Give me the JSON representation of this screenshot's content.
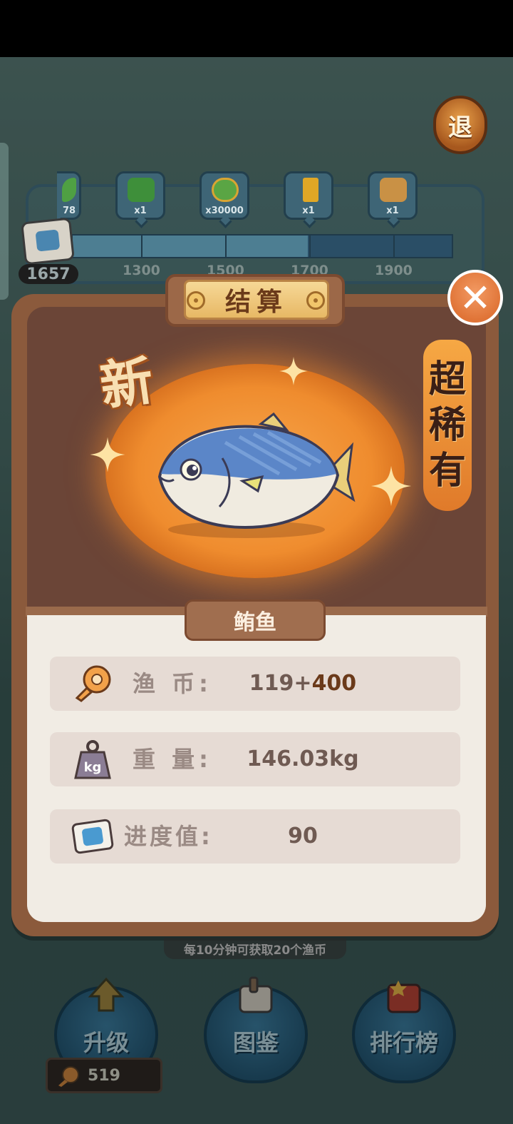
{
  "header": {
    "exit_label": "退"
  },
  "progress": {
    "current_score": "1657",
    "milestones": [
      "1300",
      "1500",
      "1700",
      "1900"
    ],
    "fill_fraction": 0.62,
    "rewards": [
      {
        "name": "leaf",
        "label": "78"
      },
      {
        "name": "leaf-check",
        "label": "x1"
      },
      {
        "name": "check-coin",
        "label": "x30000"
      },
      {
        "name": "gold-card",
        "label": "x1"
      },
      {
        "name": "cat-card",
        "label": "x1"
      }
    ]
  },
  "result": {
    "title": "结算",
    "new_tag": "新",
    "rarity": [
      "超",
      "稀",
      "有"
    ],
    "fish_name": "鲔鱼",
    "stats": {
      "coins": {
        "label": "渔 币:",
        "base": "119+",
        "bonus": "400"
      },
      "weight": {
        "label": "重 量:",
        "value": "146.03kg"
      },
      "progress": {
        "label": "进度值:",
        "value": "90"
      }
    }
  },
  "hint": "每10分钟可获取20个渔币",
  "bottom_nav": {
    "upgrade": "升级",
    "catalog": "图鉴",
    "leaderboard": "排行榜",
    "coin_balance": "519"
  },
  "colors": {
    "card": "#8b5a3c",
    "glow": "#ef8c2e",
    "accent": "#6b3a1a"
  }
}
